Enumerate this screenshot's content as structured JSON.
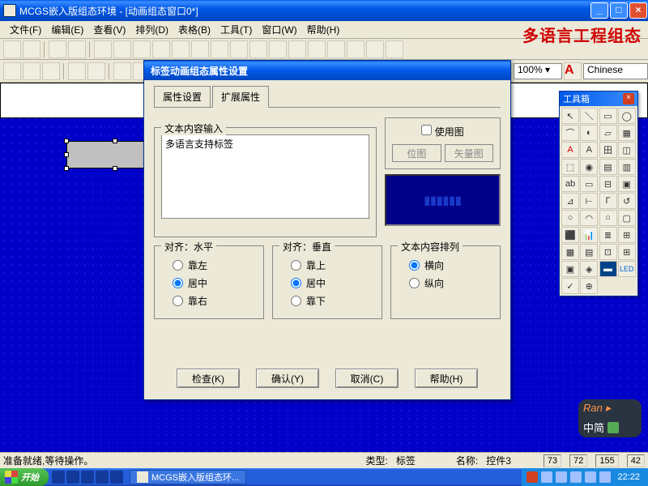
{
  "title": "MCGS嵌入版组态环境 - [动画组态窗口0*]",
  "menus": [
    "文件(F)",
    "编辑(E)",
    "查看(V)",
    "排列(D)",
    "表格(B)",
    "工具(T)",
    "窗口(W)",
    "帮助(H)"
  ],
  "overlay_text": "多语言工程组态",
  "zoom": "100% ▾",
  "language": "Chinese",
  "dialog": {
    "title": "标签动画组态属性设置",
    "tabs": [
      "属性设置",
      "扩展属性"
    ],
    "text_group_label": "文本内容输入",
    "text_value": "多语言支持标签",
    "use_image_label": "使用图",
    "use_image_checked": false,
    "pic_buttons": [
      "位图",
      "矢量图"
    ],
    "halign": {
      "legend": "对齐：水平",
      "options": [
        "靠左",
        "居中",
        "靠右"
      ],
      "selected": 1
    },
    "valign": {
      "legend": "对齐：垂直",
      "options": [
        "靠上",
        "居中",
        "靠下"
      ],
      "selected": 1
    },
    "arrange": {
      "legend": "文本内容排列",
      "options": [
        "横向",
        "纵向"
      ],
      "selected": 0
    },
    "buttons": {
      "check": "检查(K)",
      "ok": "确认(Y)",
      "cancel": "取消(C)",
      "help": "帮助(H)"
    }
  },
  "toolbox_title": "工具箱",
  "status": {
    "ready": "准备就绪,等待操作。",
    "type_label": "类型:",
    "type_value": "标签",
    "name_label": "名称:",
    "name_value": "控件3",
    "coords": [
      "73",
      "72",
      "155",
      "42"
    ]
  },
  "watermark": {
    "line1": "Ran ▸",
    "line2": "中简"
  },
  "taskbar": {
    "start": "开始",
    "app": "MCGS嵌入版组态环...",
    "clock": "22:22"
  }
}
